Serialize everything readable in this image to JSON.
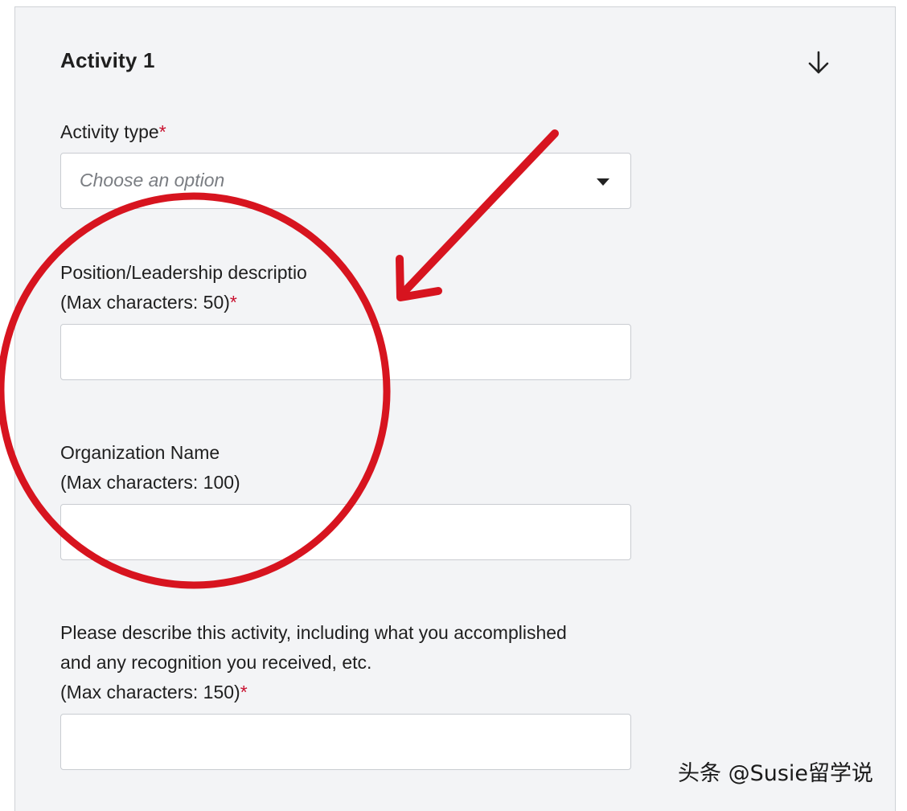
{
  "activity": {
    "title": "Activity 1",
    "collapse_icon": "arrow-down-icon"
  },
  "fields": {
    "activity_type": {
      "label": "Activity type",
      "required_mark": "*",
      "placeholder": "Choose an option"
    },
    "position": {
      "label_line1": "Position/Leadership descriptio",
      "label_line2": "(Max characters: 50)",
      "required_mark": "*",
      "value": ""
    },
    "organization": {
      "label_line1": "Organization Name",
      "label_line2": "(Max characters: 100)",
      "value": ""
    },
    "description": {
      "label_line1": "Please describe this activity, including what you accomplished",
      "label_line2": "and any recognition you received, etc.",
      "label_line3": "(Max characters: 150)",
      "required_mark": "*",
      "value": ""
    }
  },
  "annotation": {
    "color": "#d7141f"
  },
  "colors": {
    "panel_bg": "#f3f4f6",
    "required": "#c8102e"
  },
  "watermark": "头条 @Susie留学说"
}
